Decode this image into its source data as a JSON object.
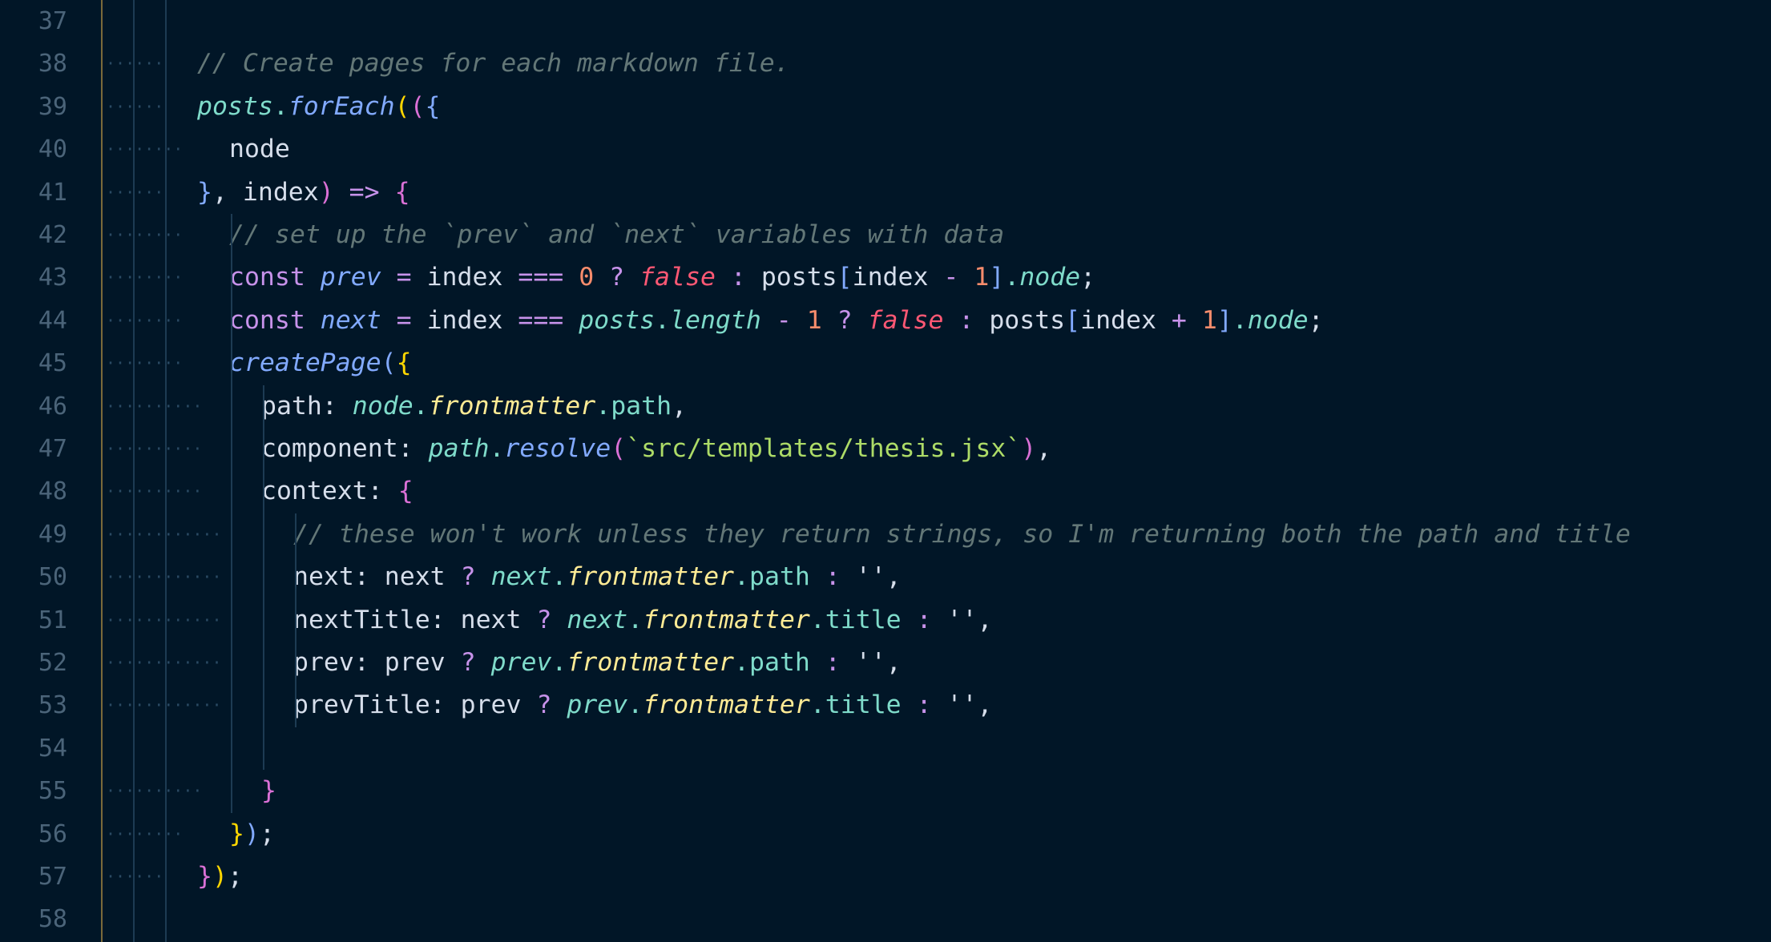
{
  "editor": {
    "theme_colors": {
      "background": "#011627",
      "line_number": "#4b6479",
      "comment": "#637777",
      "keyword": "#c792ea",
      "function": "#82aaff",
      "string": "#addb67",
      "number": "#f78c6c",
      "boolean": "#ff5874",
      "property": "#7fdbca",
      "method_yellow": "#ffeb95",
      "bracket_gold": "#ffd700",
      "bracket_pink": "#da70d6"
    },
    "lines": [
      {
        "num": "37",
        "indent": 0,
        "tokens": []
      },
      {
        "num": "38",
        "indent": 2,
        "tokens": [
          {
            "t": "// Create pages for each markdown file.",
            "c": "comment"
          }
        ]
      },
      {
        "num": "39",
        "indent": 2,
        "tokens": [
          {
            "t": "posts",
            "c": "var"
          },
          {
            "t": ".",
            "c": "obj"
          },
          {
            "t": "forEach",
            "c": "fn"
          },
          {
            "t": "(",
            "c": "brk1"
          },
          {
            "t": "(",
            "c": "brk2"
          },
          {
            "t": "{",
            "c": "brk3"
          }
        ]
      },
      {
        "num": "40",
        "indent": 3,
        "tokens": [
          {
            "t": "node",
            "c": "plain"
          }
        ]
      },
      {
        "num": "41",
        "indent": 2,
        "tokens": [
          {
            "t": "}",
            "c": "brk3"
          },
          {
            "t": ", index",
            "c": "plain"
          },
          {
            "t": ")",
            "c": "brk2"
          },
          {
            "t": " => ",
            "c": "kw"
          },
          {
            "t": "{",
            "c": "brk2"
          }
        ]
      },
      {
        "num": "42",
        "indent": 3,
        "tokens": [
          {
            "t": "// set up the `prev` and `next` variables with data",
            "c": "comment"
          }
        ]
      },
      {
        "num": "43",
        "indent": 3,
        "tokens": [
          {
            "t": "const ",
            "c": "kw"
          },
          {
            "t": "prev",
            "c": "fn"
          },
          {
            "t": " = ",
            "c": "op"
          },
          {
            "t": "index ",
            "c": "plain"
          },
          {
            "t": "=== ",
            "c": "op"
          },
          {
            "t": "0",
            "c": "num"
          },
          {
            "t": " ? ",
            "c": "op"
          },
          {
            "t": "false",
            "c": "bool"
          },
          {
            "t": " : ",
            "c": "op"
          },
          {
            "t": "posts",
            "c": "plain"
          },
          {
            "t": "[",
            "c": "brk3"
          },
          {
            "t": "index ",
            "c": "plain"
          },
          {
            "t": "- ",
            "c": "op"
          },
          {
            "t": "1",
            "c": "num"
          },
          {
            "t": "]",
            "c": "brk3"
          },
          {
            "t": ".",
            "c": "obj"
          },
          {
            "t": "node",
            "c": "var"
          },
          {
            "t": ";",
            "c": "punct"
          }
        ]
      },
      {
        "num": "44",
        "indent": 3,
        "tokens": [
          {
            "t": "const ",
            "c": "kw"
          },
          {
            "t": "next",
            "c": "fn"
          },
          {
            "t": " = ",
            "c": "op"
          },
          {
            "t": "index ",
            "c": "plain"
          },
          {
            "t": "=== ",
            "c": "op"
          },
          {
            "t": "posts",
            "c": "var"
          },
          {
            "t": ".",
            "c": "obj"
          },
          {
            "t": "length",
            "c": "var"
          },
          {
            "t": " - ",
            "c": "op"
          },
          {
            "t": "1",
            "c": "num"
          },
          {
            "t": " ? ",
            "c": "op"
          },
          {
            "t": "false",
            "c": "bool"
          },
          {
            "t": " : ",
            "c": "op"
          },
          {
            "t": "posts",
            "c": "plain"
          },
          {
            "t": "[",
            "c": "brk3"
          },
          {
            "t": "index ",
            "c": "plain"
          },
          {
            "t": "+ ",
            "c": "op"
          },
          {
            "t": "1",
            "c": "num"
          },
          {
            "t": "]",
            "c": "brk3"
          },
          {
            "t": ".",
            "c": "obj"
          },
          {
            "t": "node",
            "c": "var"
          },
          {
            "t": ";",
            "c": "punct"
          }
        ]
      },
      {
        "num": "45",
        "indent": 3,
        "tokens": [
          {
            "t": "createPage",
            "c": "fn"
          },
          {
            "t": "(",
            "c": "brk3"
          },
          {
            "t": "{",
            "c": "brk1"
          }
        ]
      },
      {
        "num": "46",
        "indent": 4,
        "tokens": [
          {
            "t": "path: ",
            "c": "plain"
          },
          {
            "t": "node",
            "c": "var"
          },
          {
            "t": ".",
            "c": "obj"
          },
          {
            "t": "frontmatter",
            "c": "prop"
          },
          {
            "t": ".",
            "c": "obj"
          },
          {
            "t": "path",
            "c": "param"
          },
          {
            "t": ",",
            "c": "punct"
          }
        ]
      },
      {
        "num": "47",
        "indent": 4,
        "tokens": [
          {
            "t": "component: ",
            "c": "plain"
          },
          {
            "t": "path",
            "c": "var"
          },
          {
            "t": ".",
            "c": "obj"
          },
          {
            "t": "resolve",
            "c": "fn"
          },
          {
            "t": "(",
            "c": "brk2"
          },
          {
            "t": "`src/templates/thesis.jsx`",
            "c": "str"
          },
          {
            "t": ")",
            "c": "brk2"
          },
          {
            "t": ",",
            "c": "punct"
          }
        ]
      },
      {
        "num": "48",
        "indent": 4,
        "tokens": [
          {
            "t": "context: ",
            "c": "plain"
          },
          {
            "t": "{",
            "c": "brk2"
          }
        ]
      },
      {
        "num": "49",
        "indent": 5,
        "tokens": [
          {
            "t": "// these won't work unless they return strings, so I'm returning both the path and title",
            "c": "comment"
          }
        ]
      },
      {
        "num": "50",
        "indent": 5,
        "tokens": [
          {
            "t": "next: next ",
            "c": "plain"
          },
          {
            "t": "? ",
            "c": "op"
          },
          {
            "t": "next",
            "c": "var"
          },
          {
            "t": ".",
            "c": "obj"
          },
          {
            "t": "frontmatter",
            "c": "prop"
          },
          {
            "t": ".",
            "c": "obj"
          },
          {
            "t": "path",
            "c": "param"
          },
          {
            "t": " : ",
            "c": "op"
          },
          {
            "t": "''",
            "c": "plain"
          },
          {
            "t": ",",
            "c": "punct"
          }
        ]
      },
      {
        "num": "51",
        "indent": 5,
        "tokens": [
          {
            "t": "nextTitle: next ",
            "c": "plain"
          },
          {
            "t": "? ",
            "c": "op"
          },
          {
            "t": "next",
            "c": "var"
          },
          {
            "t": ".",
            "c": "obj"
          },
          {
            "t": "frontmatter",
            "c": "prop"
          },
          {
            "t": ".",
            "c": "obj"
          },
          {
            "t": "title",
            "c": "param"
          },
          {
            "t": " : ",
            "c": "op"
          },
          {
            "t": "''",
            "c": "plain"
          },
          {
            "t": ",",
            "c": "punct"
          }
        ]
      },
      {
        "num": "52",
        "indent": 5,
        "tokens": [
          {
            "t": "prev: prev ",
            "c": "plain"
          },
          {
            "t": "? ",
            "c": "op"
          },
          {
            "t": "prev",
            "c": "var"
          },
          {
            "t": ".",
            "c": "obj"
          },
          {
            "t": "frontmatter",
            "c": "prop"
          },
          {
            "t": ".",
            "c": "obj"
          },
          {
            "t": "path",
            "c": "param"
          },
          {
            "t": " : ",
            "c": "op"
          },
          {
            "t": "''",
            "c": "plain"
          },
          {
            "t": ",",
            "c": "punct"
          }
        ]
      },
      {
        "num": "53",
        "indent": 5,
        "tokens": [
          {
            "t": "prevTitle: prev ",
            "c": "plain"
          },
          {
            "t": "? ",
            "c": "op"
          },
          {
            "t": "prev",
            "c": "var"
          },
          {
            "t": ".",
            "c": "obj"
          },
          {
            "t": "frontmatter",
            "c": "prop"
          },
          {
            "t": ".",
            "c": "obj"
          },
          {
            "t": "title",
            "c": "param"
          },
          {
            "t": " : ",
            "c": "op"
          },
          {
            "t": "''",
            "c": "plain"
          },
          {
            "t": ",",
            "c": "punct"
          }
        ]
      },
      {
        "num": "54",
        "indent": 0,
        "tokens": []
      },
      {
        "num": "55",
        "indent": 4,
        "tokens": [
          {
            "t": "}",
            "c": "brk2"
          }
        ]
      },
      {
        "num": "56",
        "indent": 3,
        "tokens": [
          {
            "t": "}",
            "c": "brk1"
          },
          {
            "t": ")",
            "c": "brk3"
          },
          {
            "t": ";",
            "c": "punct"
          }
        ]
      },
      {
        "num": "57",
        "indent": 2,
        "tokens": [
          {
            "t": "}",
            "c": "brk2"
          },
          {
            "t": ")",
            "c": "brk1"
          },
          {
            "t": ";",
            "c": "punct"
          }
        ]
      },
      {
        "num": "58",
        "indent": 0,
        "tokens": []
      }
    ]
  }
}
